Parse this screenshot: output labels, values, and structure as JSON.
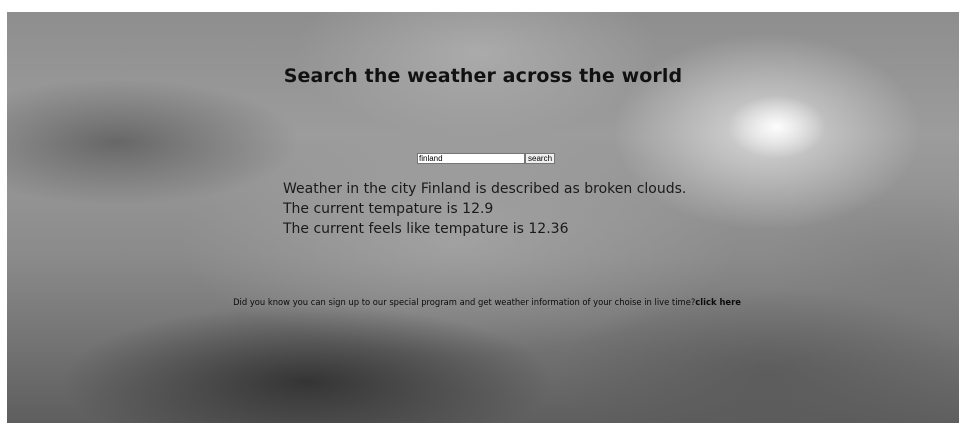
{
  "header": {
    "title": "Search the weather across the world"
  },
  "search": {
    "value": "finland",
    "button_label": "search"
  },
  "results": {
    "description_line": "Weather in the city Finland is described as broken clouds.",
    "temperature_line": "The current tempature is 12.9",
    "feels_like_line": "The current feels like tempature is 12.36"
  },
  "promo": {
    "text": "Did you know you can sign up to our special program and get weather information of your choise in live time?",
    "link_label": "click here"
  }
}
